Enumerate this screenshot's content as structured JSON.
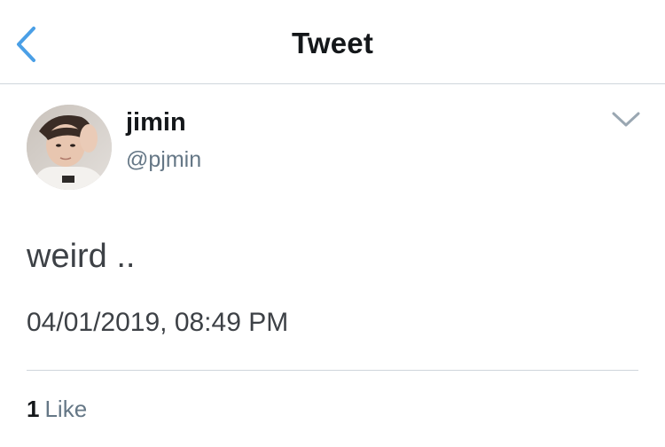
{
  "header": {
    "title": "Tweet",
    "back_icon": "chevron-left-icon",
    "accent_color": "#4a9fe6"
  },
  "tweet": {
    "author": {
      "display_name": "jimin",
      "handle": "@pjmin",
      "avatar_icon": "profile-photo"
    },
    "menu_icon": "chevron-down-icon",
    "text": "weird ..",
    "timestamp": "04/01/2019, 08:49 PM",
    "likes": {
      "count": "1",
      "label": "Like"
    }
  },
  "colors": {
    "primary_text": "#14171a",
    "secondary_text": "#657786",
    "body_text": "#3d4146",
    "divider": "#cfd6dc"
  }
}
